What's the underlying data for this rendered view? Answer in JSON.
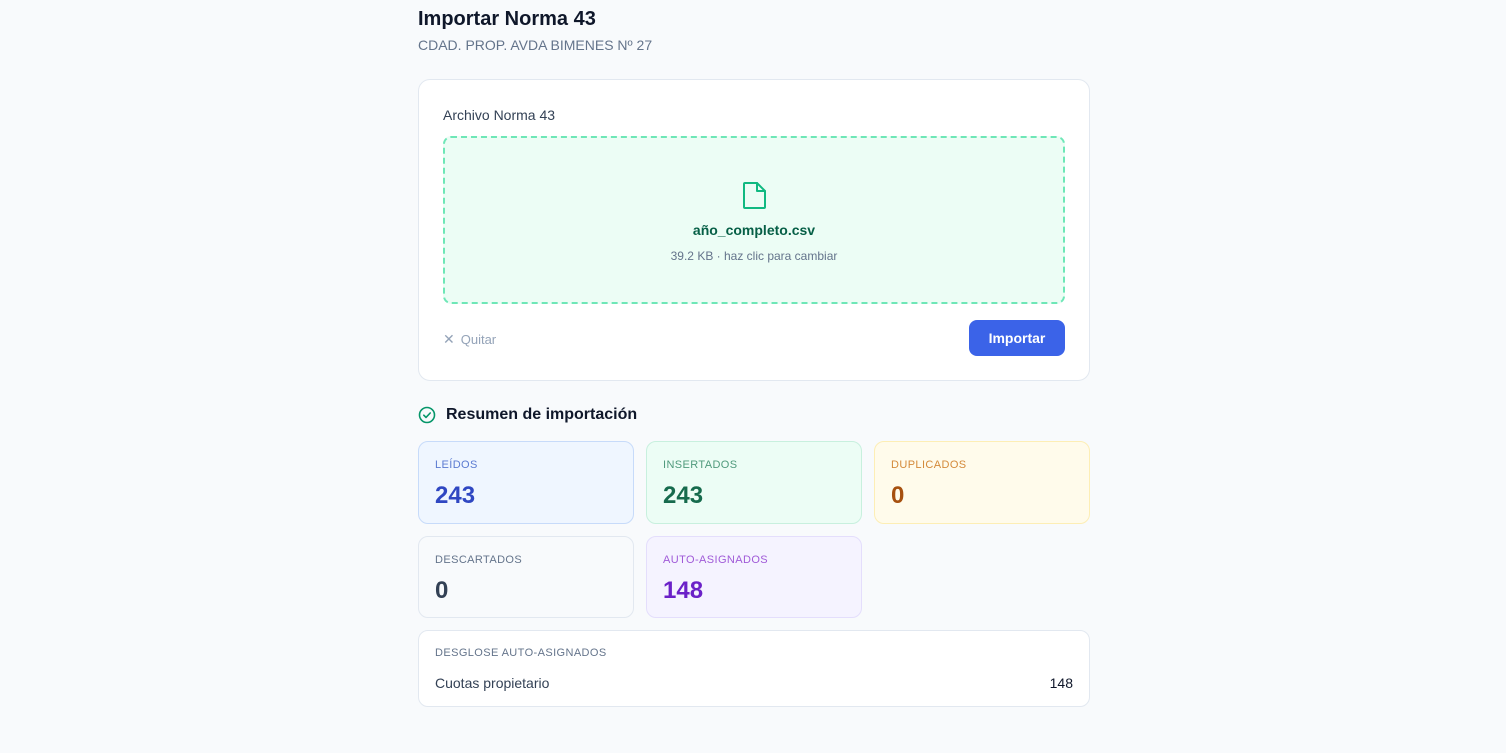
{
  "header": {
    "title": "Importar Norma 43",
    "subtitle": "CDAD. PROP. AVDA BIMENES Nº 27"
  },
  "upload": {
    "field_label": "Archivo Norma 43",
    "file_name": "año_completo.csv",
    "file_meta": "39.2 KB · haz clic para cambiar",
    "file_icon": "file-icon",
    "remove_label": "Quitar",
    "import_label": "Importar"
  },
  "summary": {
    "title": "Resumen de importación",
    "icon": "check-circle-icon",
    "stats": {
      "leidos": {
        "label": "LEÍDOS",
        "value": "243"
      },
      "insertados": {
        "label": "INSERTADOS",
        "value": "243"
      },
      "duplicados": {
        "label": "DUPLICADOS",
        "value": "0"
      },
      "descartados": {
        "label": "DESCARTADOS",
        "value": "0"
      },
      "auto": {
        "label": "AUTO-ASIGNADOS",
        "value": "148"
      }
    }
  },
  "breakdown": {
    "title": "DESGLOSE AUTO-ASIGNADOS",
    "rows": [
      {
        "name": "Cuotas propietario",
        "count": "148"
      }
    ]
  },
  "colors": {
    "primary": "#3b63e8",
    "success": "#10b981",
    "dropzone_bg": "#ecfdf5",
    "dropzone_border": "#6ee7b7"
  }
}
